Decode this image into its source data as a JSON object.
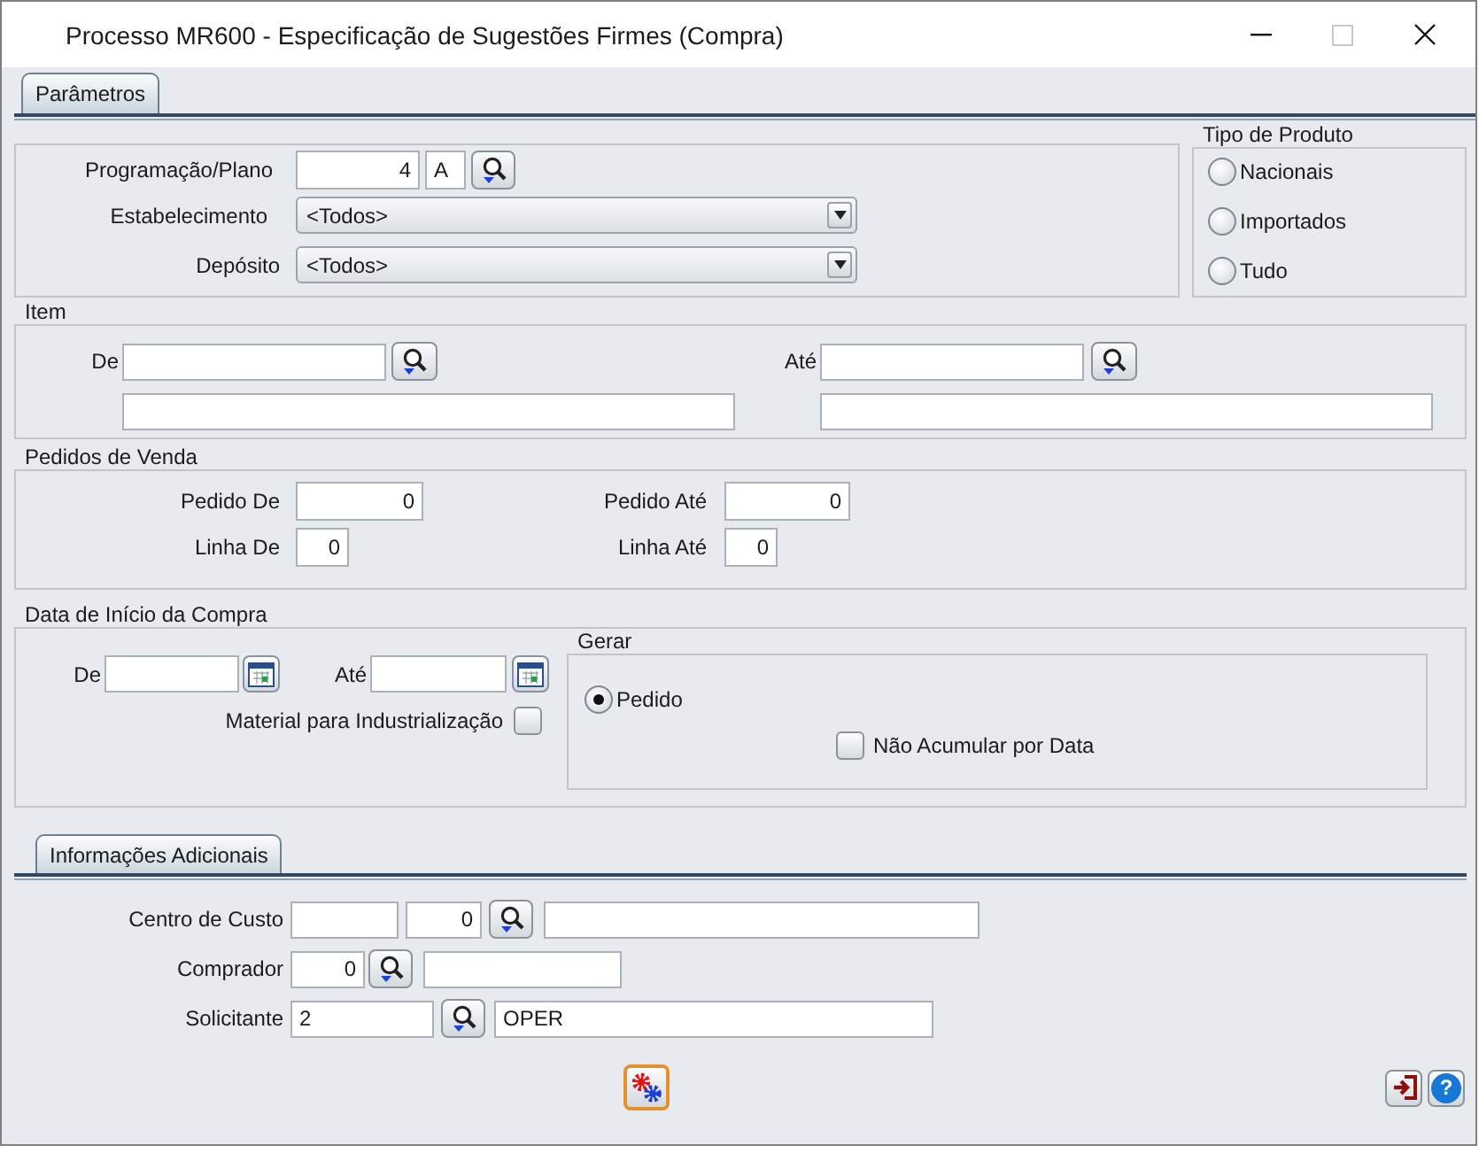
{
  "window": {
    "title": "Processo MR600 - Especificação de Sugestões Firmes (Compra)"
  },
  "tabs": [
    {
      "label": "Parâmetros",
      "selected": true
    }
  ],
  "programacao": {
    "label": "Programação/Plano",
    "value": "4",
    "plan": "A"
  },
  "estabelecimento": {
    "label": "Estabelecimento",
    "value": "<Todos>"
  },
  "deposito": {
    "label": "Depósito",
    "value": "<Todos>"
  },
  "tipo_de_produto": {
    "title": "Tipo de Produto",
    "options": [
      {
        "label": "Nacionais",
        "selected": false
      },
      {
        "label": "Importados",
        "selected": false
      },
      {
        "label": "Tudo",
        "selected": false
      }
    ]
  },
  "item": {
    "title": "Item",
    "from": {
      "label": "De"
    },
    "to": {
      "label": "Até"
    }
  },
  "pedidos_de_venda": {
    "title": "Pedidos de Venda",
    "pedido_de": {
      "label": "Pedido De",
      "value": "0"
    },
    "pedido_ate": {
      "label": "Pedido Até",
      "value": "0"
    },
    "linha_de": {
      "label": "Linha De",
      "value": "0"
    },
    "linha_ate": {
      "label": "Linha Até",
      "value": "0"
    }
  },
  "data_inicio": {
    "title": "Data de Início da Compra",
    "from": {
      "label": "De"
    },
    "to": {
      "label": "Até"
    },
    "material": {
      "label": "Material para Industrialização",
      "checked": false
    }
  },
  "gerar": {
    "title": "Gerar",
    "options": [
      {
        "label": "Pedido",
        "selected": true
      }
    ],
    "nao_acumular": {
      "label": "Não Acumular por Data",
      "checked": false
    }
  },
  "info_tabs": [
    {
      "label": "Informações Adicionais",
      "selected": true
    }
  ],
  "centro_de_custo": {
    "label": "Centro de Custo",
    "value": "0"
  },
  "comprador": {
    "label": "Comprador",
    "value": "0"
  },
  "solicitante": {
    "label": "Solicitante",
    "value": "2",
    "name": "OPER"
  },
  "help_button": {
    "label": "?"
  }
}
